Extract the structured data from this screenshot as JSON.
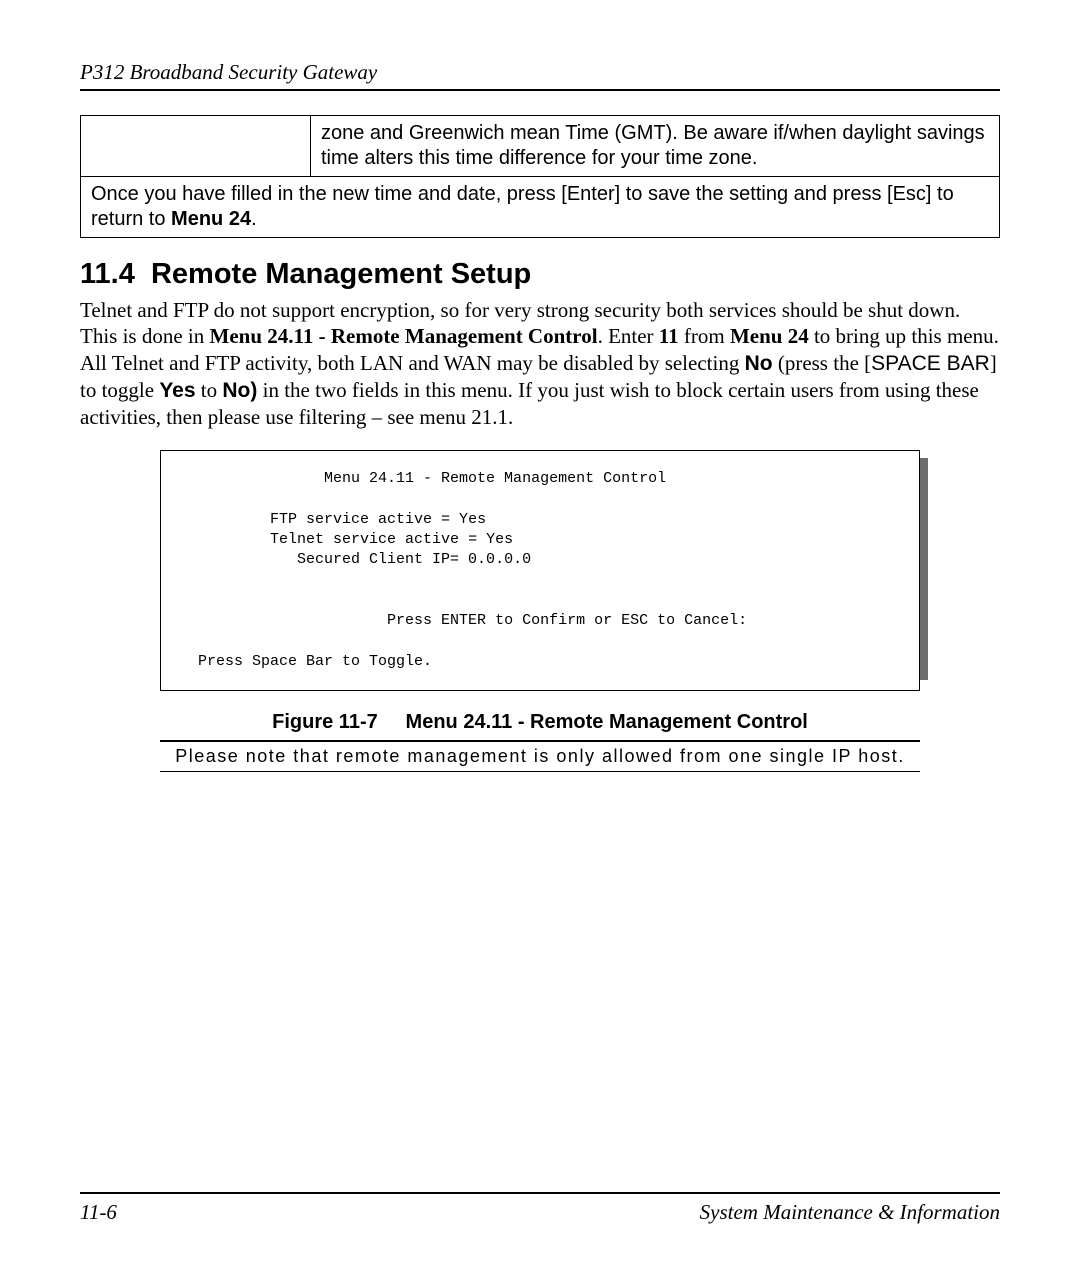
{
  "header": {
    "title": "P312  Broadband Security Gateway"
  },
  "table": {
    "cell_right": "zone and Greenwich mean Time (GMT). Be aware if/when daylight savings time alters this time difference for your time zone.",
    "full_prefix": "Once you have filled in the new time and date, press [Enter] to save the setting and press [Esc] to return to ",
    "full_bold": "Menu 24",
    "full_suffix": "."
  },
  "section": {
    "number": "11.4",
    "title": "Remote Management Setup"
  },
  "paragraph": {
    "p1": "Telnet and FTP do not support encryption, so for very strong security both services should be shut down. This is done in ",
    "p1_bold1": "Menu 24.11 - Remote Management Control",
    "p1_mid1": ". Enter ",
    "p1_bold2": "11",
    "p1_mid2": " from ",
    "p1_bold3": "Menu 24",
    "p1_mid3": " to bring up this menu. All Telnet and FTP activity, both LAN and WAN may be disabled by selecting ",
    "p1_bold4_sans": "No",
    "p1_mid4": " (press the [",
    "p1_spacer_sans": "SPACE BAR",
    "p1_mid5": "] to toggle ",
    "p1_bold5_sans": "Yes",
    "p1_mid6": " to ",
    "p1_bold6_sans": "No)",
    "p1_tail": " in the two fields in this menu. If you just wish to block certain users from using these activities, then please use filtering – see menu 21.1."
  },
  "terminal": {
    "title": "Menu 24.11 - Remote Management Control",
    "line1": "FTP service active = Yes",
    "line2": "Telnet service active = Yes",
    "line3": "Secured Client IP= 0.0.0.0",
    "prompt": "Press ENTER to Confirm or ESC to Cancel:",
    "footer": "Press Space Bar to Toggle."
  },
  "figure": {
    "label": "Figure 11-7",
    "caption": "Menu 24.11 - Remote Management Control"
  },
  "note": {
    "text": "Please note that remote management is only allowed from one single IP host."
  },
  "footer": {
    "page": "11-6",
    "section": "System Maintenance & Information"
  }
}
